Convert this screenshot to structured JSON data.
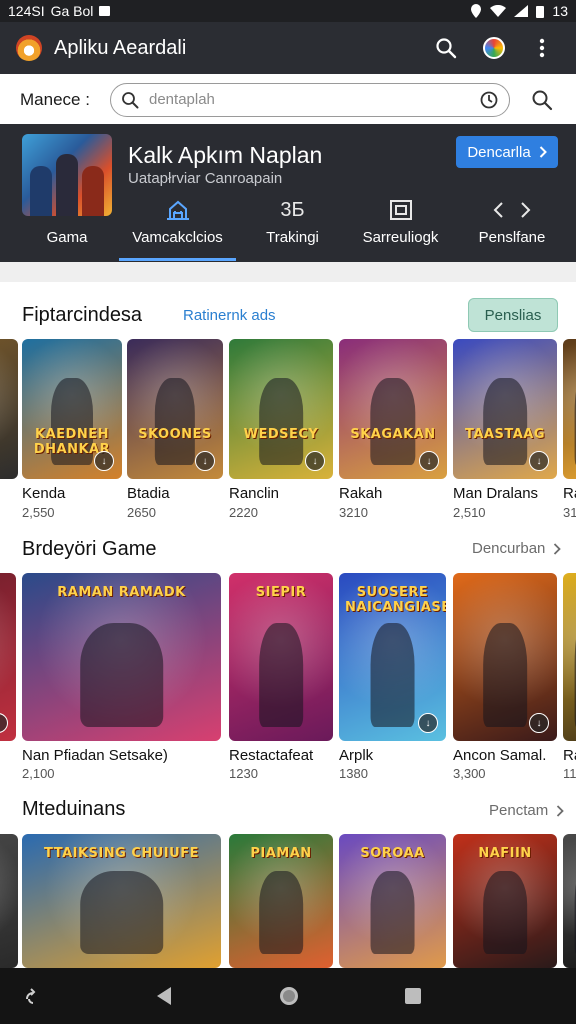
{
  "status_bar": {
    "time_text": "124SI",
    "carrier_text": "Ga Bol",
    "battery_text": "13"
  },
  "app_bar": {
    "title": "Apliku Aeardali"
  },
  "search": {
    "label": "Manece :",
    "placeholder": "dentaplah"
  },
  "featured": {
    "title": "Kalk Apkım Naplan",
    "subtitle": "Uatapłrviar Canroapain",
    "button_label": "Dencarlla",
    "tabs": [
      {
        "label": "Gama",
        "icon": "store-icon"
      },
      {
        "label": "Vamcakclcios",
        "icon": "building-icon"
      },
      {
        "label": "Trakingi",
        "icon": "ranking-icon",
        "icon_text": "3Б"
      },
      {
        "label": "Sarreuliogk",
        "icon": "frame-icon"
      },
      {
        "label": "Penslfane",
        "icon": "code-icon"
      }
    ],
    "active_tab": 1
  },
  "sections": [
    {
      "title": "Fiptarcindesa",
      "link": "Ratinernk ads",
      "button": "Penslias",
      "cards": [
        {
          "name": "",
          "count": "",
          "logo": "",
          "colors": [
            "#7a5a2a",
            "#2d2d2d"
          ]
        },
        {
          "name": "Kenda",
          "count": "2,550",
          "logo": "KAEDNEH DHANKAR",
          "colors": [
            "#1e6fa0",
            "#d4812a"
          ]
        },
        {
          "name": "Btadia",
          "count": "2650",
          "logo": "SKOONES",
          "colors": [
            "#3a2b5a",
            "#c48a3a"
          ]
        },
        {
          "name": "Ranclin",
          "count": "2220",
          "logo": "WEDSECY",
          "colors": [
            "#2f7a3a",
            "#d9b23a"
          ]
        },
        {
          "name": "Rakah",
          "count": "3210",
          "logo": "SKAGAKAN",
          "colors": [
            "#8a2d7a",
            "#d9a040"
          ]
        },
        {
          "name": "Man Dralans",
          "count": "2,510",
          "logo": "TAASTAAG",
          "colors": [
            "#3a4ac0",
            "#e0a84a"
          ]
        },
        {
          "name": "Ra",
          "count": "31",
          "logo": "",
          "colors": [
            "#5a3a1a",
            "#e0a030"
          ]
        }
      ]
    },
    {
      "title": "Brdeyöri Game",
      "link": "Dencurban",
      "cards": [
        {
          "name": "",
          "count": "",
          "logo": "",
          "colors": [
            "#6a1d2a",
            "#c03040"
          ]
        },
        {
          "name": "Nan Pfiadan Setsake)",
          "count": "2,100",
          "logo": "RAMAN  RAMADK",
          "colors": [
            "#2a4a8a",
            "#d84070"
          ]
        },
        {
          "name": "Restactafeat",
          "count": "1230",
          "logo": "SIEPIR",
          "colors": [
            "#d0306a",
            "#6a1a5a"
          ]
        },
        {
          "name": "Arplk",
          "count": "1380",
          "logo": "SUOSERE NAICANGIASE",
          "colors": [
            "#2a4ac0",
            "#5ac0e0"
          ]
        },
        {
          "name": "Ancon Samal.",
          "count": "3,300",
          "logo": "",
          "colors": [
            "#e06a1a",
            "#3a1a1a"
          ]
        },
        {
          "name": "Ra",
          "count": "11",
          "logo": "",
          "colors": [
            "#e0b020",
            "#4a3a1a"
          ]
        }
      ]
    },
    {
      "title": "Mteduinans",
      "link": "Penctam",
      "cards": [
        {
          "name": "",
          "count": "",
          "logo": "",
          "colors": [
            "#4a4a4a",
            "#2a2a2a"
          ]
        },
        {
          "name": "",
          "count": "",
          "logo": "TTAIKSING  CHUIUFE",
          "colors": [
            "#2a6ab0",
            "#e0a030"
          ]
        },
        {
          "name": "",
          "count": "",
          "logo": "PIAMAN",
          "colors": [
            "#2a7a3a",
            "#e06030"
          ]
        },
        {
          "name": "",
          "count": "",
          "logo": "SOROAA",
          "colors": [
            "#6a4ac0",
            "#e09a4a"
          ]
        },
        {
          "name": "",
          "count": "",
          "logo": "NAFIIN",
          "colors": [
            "#c0301a",
            "#2a1a1a"
          ]
        },
        {
          "name": "",
          "count": "",
          "logo": "",
          "colors": [
            "#4a4a4a",
            "#1a1a1a"
          ]
        }
      ]
    }
  ],
  "colors": {
    "accent": "#2f7fe0",
    "header_bg": "#2b2d33",
    "pill_bg": "#bfe3d6"
  }
}
